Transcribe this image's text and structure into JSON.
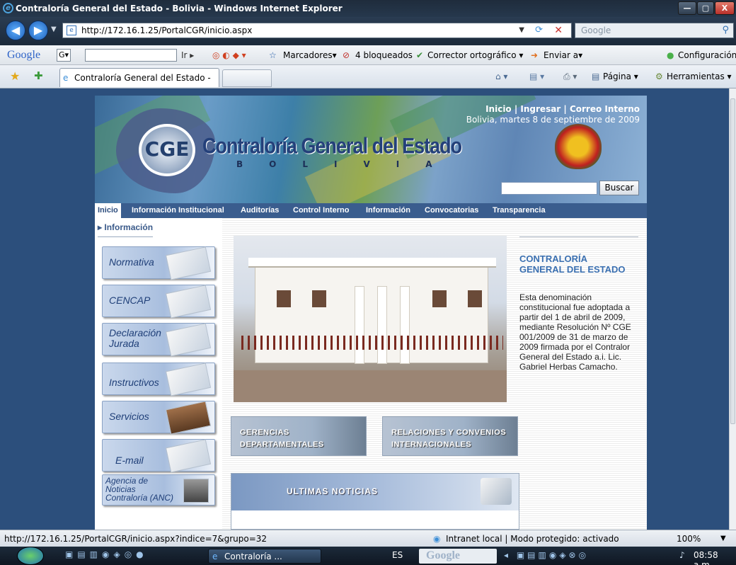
{
  "window": {
    "title": "Contraloría General del Estado - Bolivia - Windows Internet Explorer",
    "controls": [
      "—",
      "▢",
      "X"
    ]
  },
  "address": {
    "url": "http://172.16.1.25/PortalCGR/inicio.aspx",
    "search_placeholder": "Google"
  },
  "google_toolbar": {
    "brand": "Google",
    "g_field": "G▾",
    "go": "Ir ▸",
    "bookmarks": "Marcadores▾",
    "blocked": "4 bloqueados",
    "spell": "Corrector ortográfico ▾",
    "send": "Enviar a▾",
    "settings": "Configuración▾"
  },
  "tab": {
    "label": "Contraloría General del Estado - Bolivia",
    "page_menu": "Página ▾",
    "tools_menu": "Herramientas ▾"
  },
  "banner": {
    "links": "Inicio | Ingresar | Correo Interno",
    "date": "Bolivia, martes 8 de septiembre de 2009",
    "brand": "Contraloría General del Estado",
    "brand_sub": "BOLIVIA",
    "seal_initials": "CGE",
    "search_button": "Buscar"
  },
  "menu": [
    "Inicio",
    "Información Institucional",
    "Auditorías",
    "Control Interno",
    "Información",
    "Convocatorias",
    "Transparencia"
  ],
  "sidebar": {
    "crumb": "Información",
    "items": [
      "Normativa",
      "CENCAP",
      "Declaración Jurada",
      "Instructivos",
      "Servicios",
      "E-mail",
      "Agencia de Noticias Contraloría (ANC)"
    ]
  },
  "info": {
    "title": "CONTRALORÍA GENERAL DEL ESTADO",
    "text": "Esta denominación constitucional fue adoptada a partir del 1 de abril de 2009, mediante Resolución Nº CGE 001/2009 de 31 de marzo de 2009 firmada por el Contralor General del Estado a.i. Lic. Gabriel Herbas Camacho."
  },
  "banners": {
    "gerencias": "GERENCIAS DEPARTAMENTALES",
    "relaciones": "RELACIONES Y CONVENIOS INTERNACIONALES",
    "news": "ULTIMAS NOTICIAS"
  },
  "status": {
    "url": "http://172.16.1.25/PortalCGR/inicio.aspx?indice=7&grupo=32",
    "zone": "Intranet local | Modo protegido: activado",
    "zoom": "100%"
  },
  "taskbar": {
    "app": "Contraloría ...",
    "lang": "ES",
    "search": "Google",
    "time": "08:58 a.m."
  },
  "colors": {
    "accent": "#2c4f7c",
    "link": "#3a6fb0"
  }
}
